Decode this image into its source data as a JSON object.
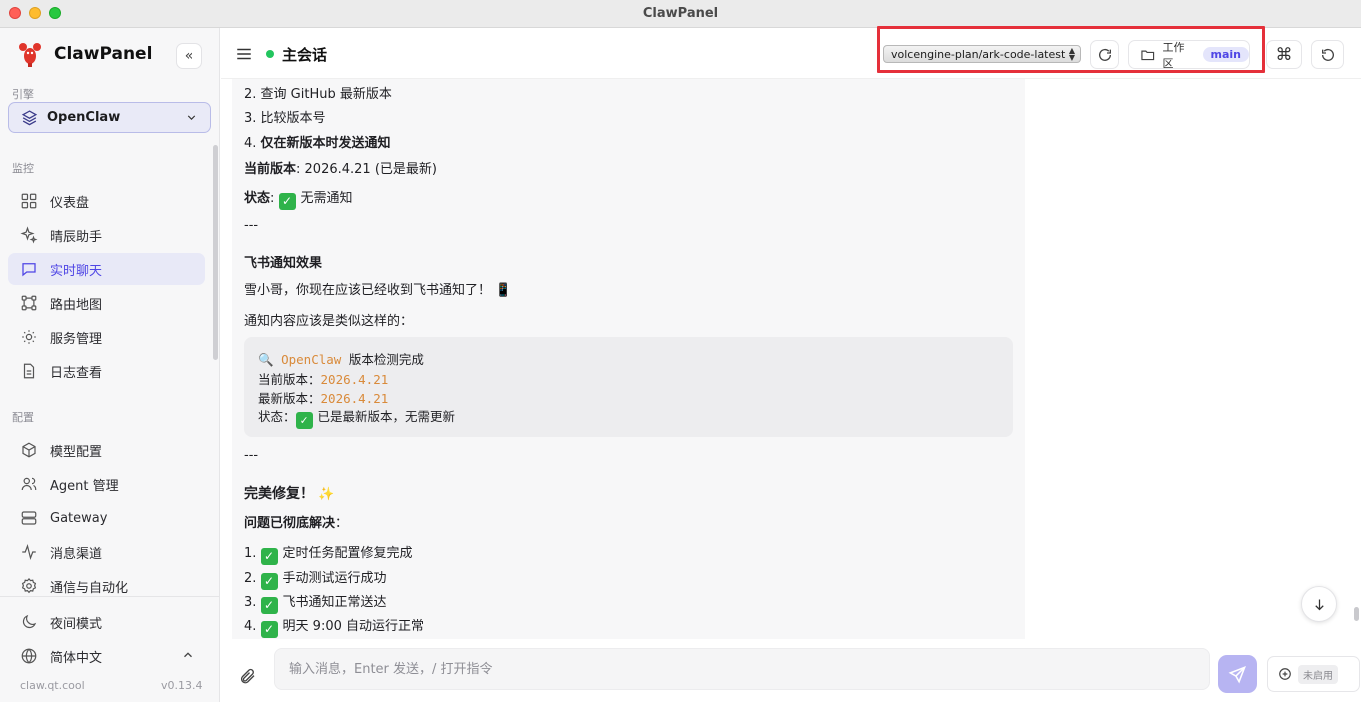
{
  "window": {
    "title": "ClawPanel"
  },
  "sidebar": {
    "brand": "ClawPanel",
    "collapse_glyph": "«",
    "engine_label": "引擎",
    "engine_value": "OpenClaw",
    "monitor_label": "监控",
    "monitor_items": [
      {
        "label": "仪表盘",
        "icon": "grid-icon"
      },
      {
        "label": "晴辰助手",
        "icon": "sparkle-icon"
      },
      {
        "label": "实时聊天",
        "icon": "chat-icon",
        "active": true
      },
      {
        "label": "路由地图",
        "icon": "route-icon"
      },
      {
        "label": "服务管理",
        "icon": "sun-icon"
      },
      {
        "label": "日志查看",
        "icon": "document-icon"
      }
    ],
    "config_label": "配置",
    "config_items": [
      {
        "label": "模型配置",
        "icon": "cube-icon"
      },
      {
        "label": "Agent 管理",
        "icon": "users-icon"
      },
      {
        "label": "Gateway",
        "icon": "server-icon"
      },
      {
        "label": "消息渠道",
        "icon": "activity-icon"
      },
      {
        "label": "通信与自动化",
        "icon": "gear-icon"
      }
    ],
    "night_mode": "夜间模式",
    "language": "简体中文",
    "footer_site": "claw.qt.cool",
    "footer_version": "v0.13.4"
  },
  "header": {
    "session_title": "主会话",
    "model": "volcengine-plan/ark-code-latest",
    "workspace_label": "工作区",
    "workspace_badge": "main",
    "shortcut_glyph": "⌘"
  },
  "message": {
    "list_top": [
      {
        "n": "2.",
        "text": "查询 GitHub 最新版本"
      },
      {
        "n": "3.",
        "text": "比较版本号"
      },
      {
        "n": "4.",
        "text": "仅在新版本时发送通知"
      }
    ],
    "current_version_label": "当前版本",
    "current_version_value": ": 2026.4.21 (已是最新)",
    "status_label": "状态",
    "status_value": "无需通知",
    "divider1": "---",
    "feishu_heading": "飞书通知效果",
    "feishu_line": "雪小哥，你现在应该已经收到飞书通知了！ 📱",
    "notice_intro": "通知内容应该是类似这样的：",
    "code": {
      "l1_icon": "🔍",
      "l1_name": "OpenClaw",
      "l1_rest": " 版本检测完成",
      "l2_label": "当前版本：",
      "l2_value": "2026.4.21",
      "l3_label": "最新版本：",
      "l3_value": "2026.4.21",
      "l4_label": "状态：",
      "l4_rest": "已是最新版本，无需更新"
    },
    "divider2": "---",
    "fixed_heading": "完美修复！",
    "fixed_emoji": "✨",
    "resolved_label": "问题已彻底解决",
    "resolved_colon": "：",
    "list_bottom": [
      {
        "n": "1.",
        "text": "定时任务配置修复完成"
      },
      {
        "n": "2.",
        "text": "手动测试运行成功"
      },
      {
        "n": "3.",
        "text": "飞书通知正常送达"
      },
      {
        "n": "4.",
        "text": "明天 9:00 自动运行正常"
      }
    ]
  },
  "input": {
    "placeholder": "输入消息，Enter 发送，/ 打开指令",
    "extra_badge": "未启用"
  }
}
